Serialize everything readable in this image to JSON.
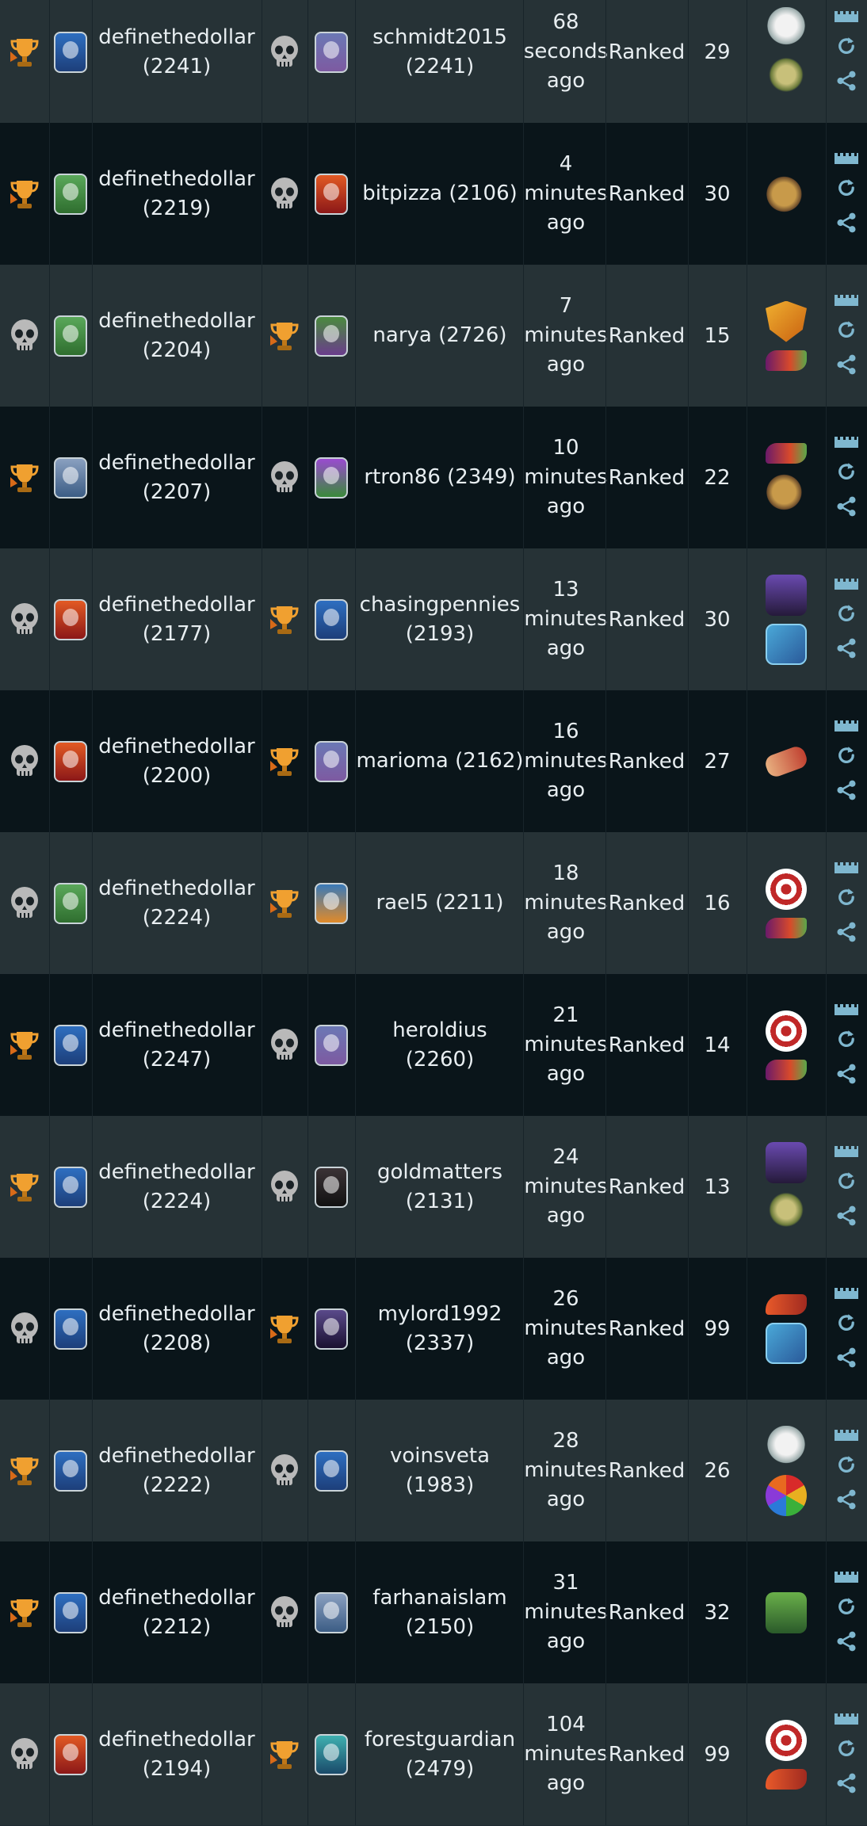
{
  "battle_type_label": "Ranked",
  "colors": {
    "row_odd": "#263236",
    "row_even": "#0a151a",
    "action_icon": "#7fb7cf",
    "trophy": "#f0a030",
    "skull": "#b9b9b9"
  },
  "actions": [
    "castle-icon",
    "replay-icon",
    "share-icon"
  ],
  "battles": [
    {
      "p1_result": "winner",
      "p1_avatar": "wizard-avatar",
      "p1_name": "definethedollar (2241)",
      "p2_result": "loser",
      "p2_avatar": "knight-avatar",
      "p2_name": "schmidt2015 (2241)",
      "time_num": "68",
      "time_unit": "seconds",
      "time_ago": "ago",
      "type": "Ranked",
      "mana": "29",
      "rules": [
        "cloud-icon",
        "goblin-icon"
      ]
    },
    {
      "p1_result": "winner",
      "p1_avatar": "elf-avatar",
      "p1_name": "definethedollar (2219)",
      "p2_result": "loser",
      "p2_avatar": "dragon-avatar",
      "p2_name": "bitpizza (2106)",
      "time_num": "4",
      "time_unit": "minutes",
      "time_ago": "ago",
      "type": "Ranked",
      "mana": "30",
      "rules": [
        "drum-icon"
      ]
    },
    {
      "p1_result": "loser",
      "p1_avatar": "elf-avatar",
      "p1_name": "definethedollar (2204)",
      "p2_result": "winner",
      "p2_avatar": "goblin-avatar",
      "p2_name": "narya (2726)",
      "time_num": "7",
      "time_unit": "minutes",
      "time_ago": "ago",
      "type": "Ranked",
      "mana": "15",
      "rules": [
        "shield-icon",
        "snail-icon"
      ]
    },
    {
      "p1_result": "winner",
      "p1_avatar": "boy-avatar",
      "p1_name": "definethedollar (2207)",
      "p2_result": "loser",
      "p2_avatar": "crit-avatar",
      "p2_name": "rtron86 (2349)",
      "time_num": "10",
      "time_unit": "minutes",
      "time_ago": "ago",
      "type": "Ranked",
      "mana": "22",
      "rules": [
        "snail-icon",
        "drum-icon"
      ]
    },
    {
      "p1_result": "loser",
      "p1_avatar": "dragon-avatar",
      "p1_name": "definethedollar (2177)",
      "p2_result": "winner",
      "p2_avatar": "wizard-avatar",
      "p2_name": "chasingpennies (2193)",
      "time_num": "13",
      "time_unit": "minutes",
      "time_ago": "ago",
      "type": "Ranked",
      "mana": "30",
      "rules": [
        "hood-icon",
        "cards-icon"
      ]
    },
    {
      "p1_result": "loser",
      "p1_avatar": "dragon-avatar",
      "p1_name": "definethedollar (2200)",
      "p2_result": "winner",
      "p2_avatar": "knight-avatar",
      "p2_name": "marioma (2162)",
      "time_num": "16",
      "time_unit": "minutes",
      "time_ago": "ago",
      "type": "Ranked",
      "mana": "27",
      "rules": [
        "bandage-icon"
      ]
    },
    {
      "p1_result": "loser",
      "p1_avatar": "elf-avatar",
      "p1_name": "definethedollar (2224)",
      "p2_result": "winner",
      "p2_avatar": "golem-avatar",
      "p2_name": "rael5 (2211)",
      "time_num": "18",
      "time_unit": "minutes",
      "time_ago": "ago",
      "type": "Ranked",
      "mana": "16",
      "rules": [
        "target-icon",
        "snail-icon"
      ]
    },
    {
      "p1_result": "winner",
      "p1_avatar": "wizard-avatar",
      "p1_name": "definethedollar (2247)",
      "p2_result": "loser",
      "p2_avatar": "knight-avatar",
      "p2_name": "heroldius (2260)",
      "time_num": "21",
      "time_unit": "minutes",
      "time_ago": "ago",
      "type": "Ranked",
      "mana": "14",
      "rules": [
        "target-icon",
        "snail-icon"
      ]
    },
    {
      "p1_result": "winner",
      "p1_avatar": "wizard-avatar",
      "p1_name": "definethedollar (2224)",
      "p2_result": "loser",
      "p2_avatar": "dark-avatar",
      "p2_name": "goldmatters (2131)",
      "time_num": "24",
      "time_unit": "minutes",
      "time_ago": "ago",
      "type": "Ranked",
      "mana": "13",
      "rules": [
        "hood-icon",
        "goblin-icon"
      ]
    },
    {
      "p1_result": "loser",
      "p1_avatar": "wizard-avatar",
      "p1_name": "definethedollar (2208)",
      "p2_result": "winner",
      "p2_avatar": "space-avatar",
      "p2_name": "mylord1992 (2337)",
      "time_num": "26",
      "time_unit": "minutes",
      "time_ago": "ago",
      "type": "Ranked",
      "mana": "99",
      "rules": [
        "shoe-icon",
        "cards-icon"
      ]
    },
    {
      "p1_result": "winner",
      "p1_avatar": "wizard-avatar",
      "p1_name": "definethedollar (2222)",
      "p2_result": "loser",
      "p2_avatar": "wizard-avatar",
      "p2_name": "voinsveta (1983)",
      "time_num": "28",
      "time_unit": "minutes",
      "time_ago": "ago",
      "type": "Ranked",
      "mana": "26",
      "rules": [
        "cloud-icon",
        "wheel-icon"
      ]
    },
    {
      "p1_result": "winner",
      "p1_avatar": "wizard-avatar",
      "p1_name": "definethedollar (2212)",
      "p2_result": "loser",
      "p2_avatar": "boy-avatar",
      "p2_name": "farhanaislam (2150)",
      "time_num": "31",
      "time_unit": "minutes",
      "time_ago": "ago",
      "type": "Ranked",
      "mana": "32",
      "rules": [
        "orc-icon"
      ]
    },
    {
      "p1_result": "loser",
      "p1_avatar": "dragon-avatar",
      "p1_name": "definethedollar (2194)",
      "p2_result": "winner",
      "p2_avatar": "water-avatar",
      "p2_name": "forestguardian (2479)",
      "time_num": "104",
      "time_unit": "minutes",
      "time_ago": "ago",
      "type": "Ranked",
      "mana": "99",
      "rules": [
        "target-icon",
        "shoe-icon"
      ]
    }
  ]
}
